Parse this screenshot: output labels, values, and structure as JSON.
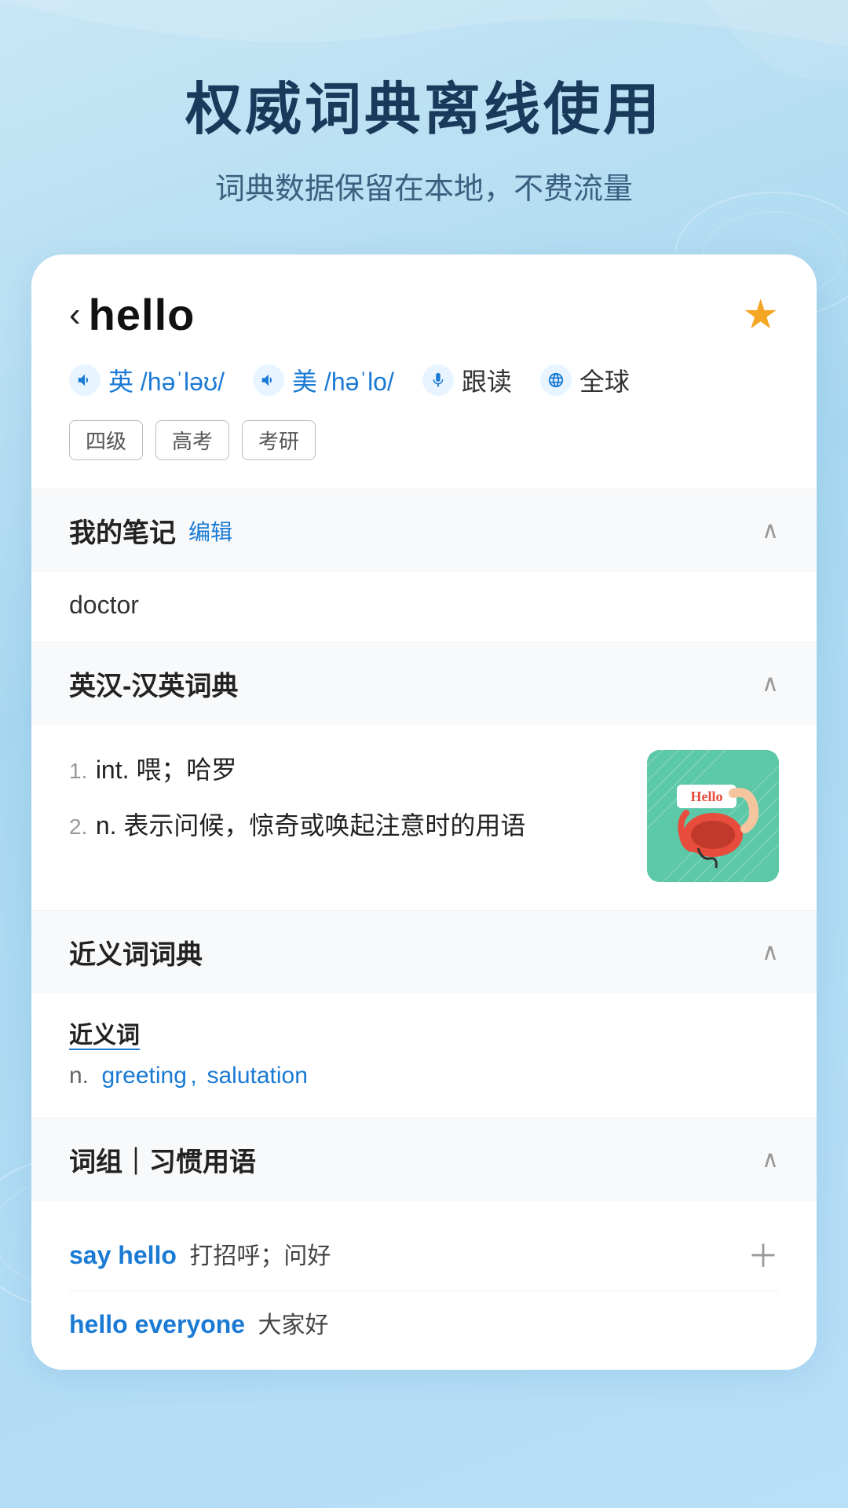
{
  "hero": {
    "title": "权威词典离线使用",
    "subtitle": "词典数据保留在本地，不费流量"
  },
  "word_header": {
    "back_label": "‹",
    "word": "hello",
    "star_icon": "★",
    "pron_en_icon": "volume",
    "pron_en_label": "英 /həˈləʊ/",
    "pron_us_icon": "volume",
    "pron_us_label": "美 /həˈlo/",
    "follow_read_icon": "mic",
    "follow_read_label": "跟读",
    "global_icon": "global",
    "global_label": "全球",
    "tags": [
      "四级",
      "高考",
      "考研"
    ]
  },
  "notes_section": {
    "title": "我的笔记",
    "edit_label": "编辑",
    "chevron": "∧",
    "note_text": "doctor"
  },
  "dict_section": {
    "title": "英汉-汉英词典",
    "chevron": "∧",
    "entries": [
      {
        "num": "1.",
        "type": "int.",
        "def": "喂；哈罗"
      },
      {
        "num": "2.",
        "type": "n.",
        "def": "表示问候，惊奇或唤起注意时的用语"
      }
    ],
    "image_alt": "Hello telephone illustration"
  },
  "synonyms_section": {
    "title": "近义词词典",
    "chevron": "∧",
    "label": "近义词",
    "pos": "n.",
    "synonyms": [
      "greeting",
      "salutation"
    ]
  },
  "phrases_section": {
    "title": "词组｜习惯用语",
    "chevron": "∧",
    "phrases": [
      {
        "en": "say hello",
        "cn": "打招呼；问好",
        "has_plus": true
      },
      {
        "en": "hello everyone",
        "cn": "大家好",
        "has_plus": false
      }
    ]
  },
  "colors": {
    "accent_blue": "#1a7ad4",
    "star_gold": "#f5a623",
    "bg_light": "#c8e6f5"
  }
}
